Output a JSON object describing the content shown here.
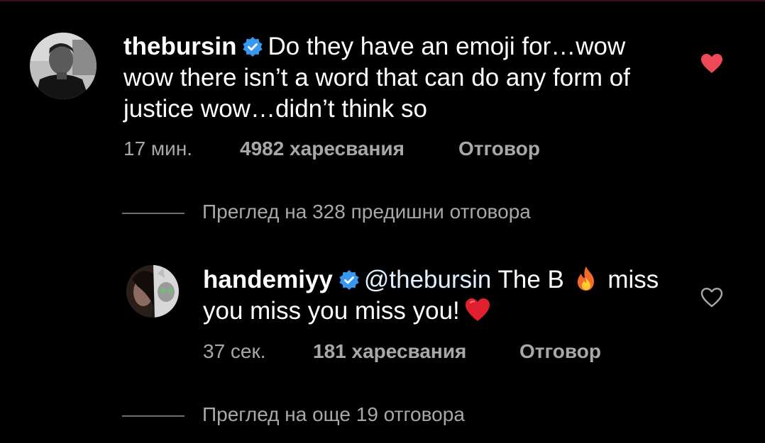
{
  "comments": [
    {
      "username": "thebursin",
      "text": "Do they have an emoji for…wow wow there isn’t a word that can do any form of justice wow…didn’t think so",
      "text_line1": "Do they have an emoji for…wow",
      "text_line2": "wow there isn’t a word that can do any form of",
      "text_line3": "justice wow…didn’t think so",
      "time": "17 мин.",
      "likes": "4982 харесвания",
      "reply_label": "Отговор",
      "liked": true,
      "avatar_icon": "profile-photo-man"
    },
    {
      "username": "handemiyy",
      "mention": "@thebursin",
      "text_part1": "The B",
      "emoji1": "fire-emoji",
      "text_part2": "miss",
      "text_line2": "you miss you miss you!",
      "emoji2": "red-heart-emoji",
      "time": "37 сек.",
      "likes": "181 харесвания",
      "reply_label": "Отговор",
      "liked": false,
      "avatar_icon": "profile-photo-woman-cat"
    }
  ],
  "view_previous": "Преглед на 328 предишни отговора",
  "view_more": "Преглед на още 19 отговора",
  "colors": {
    "background": "#000000",
    "text": "#ffffff",
    "meta_text": "#a8a8a8",
    "verified_blue": "#3897f0",
    "like_red": "#ed4956",
    "outline_heart": "#a8a8a8"
  },
  "icons": [
    "verified-badge-icon",
    "heart-filled-icon",
    "heart-outline-icon"
  ]
}
